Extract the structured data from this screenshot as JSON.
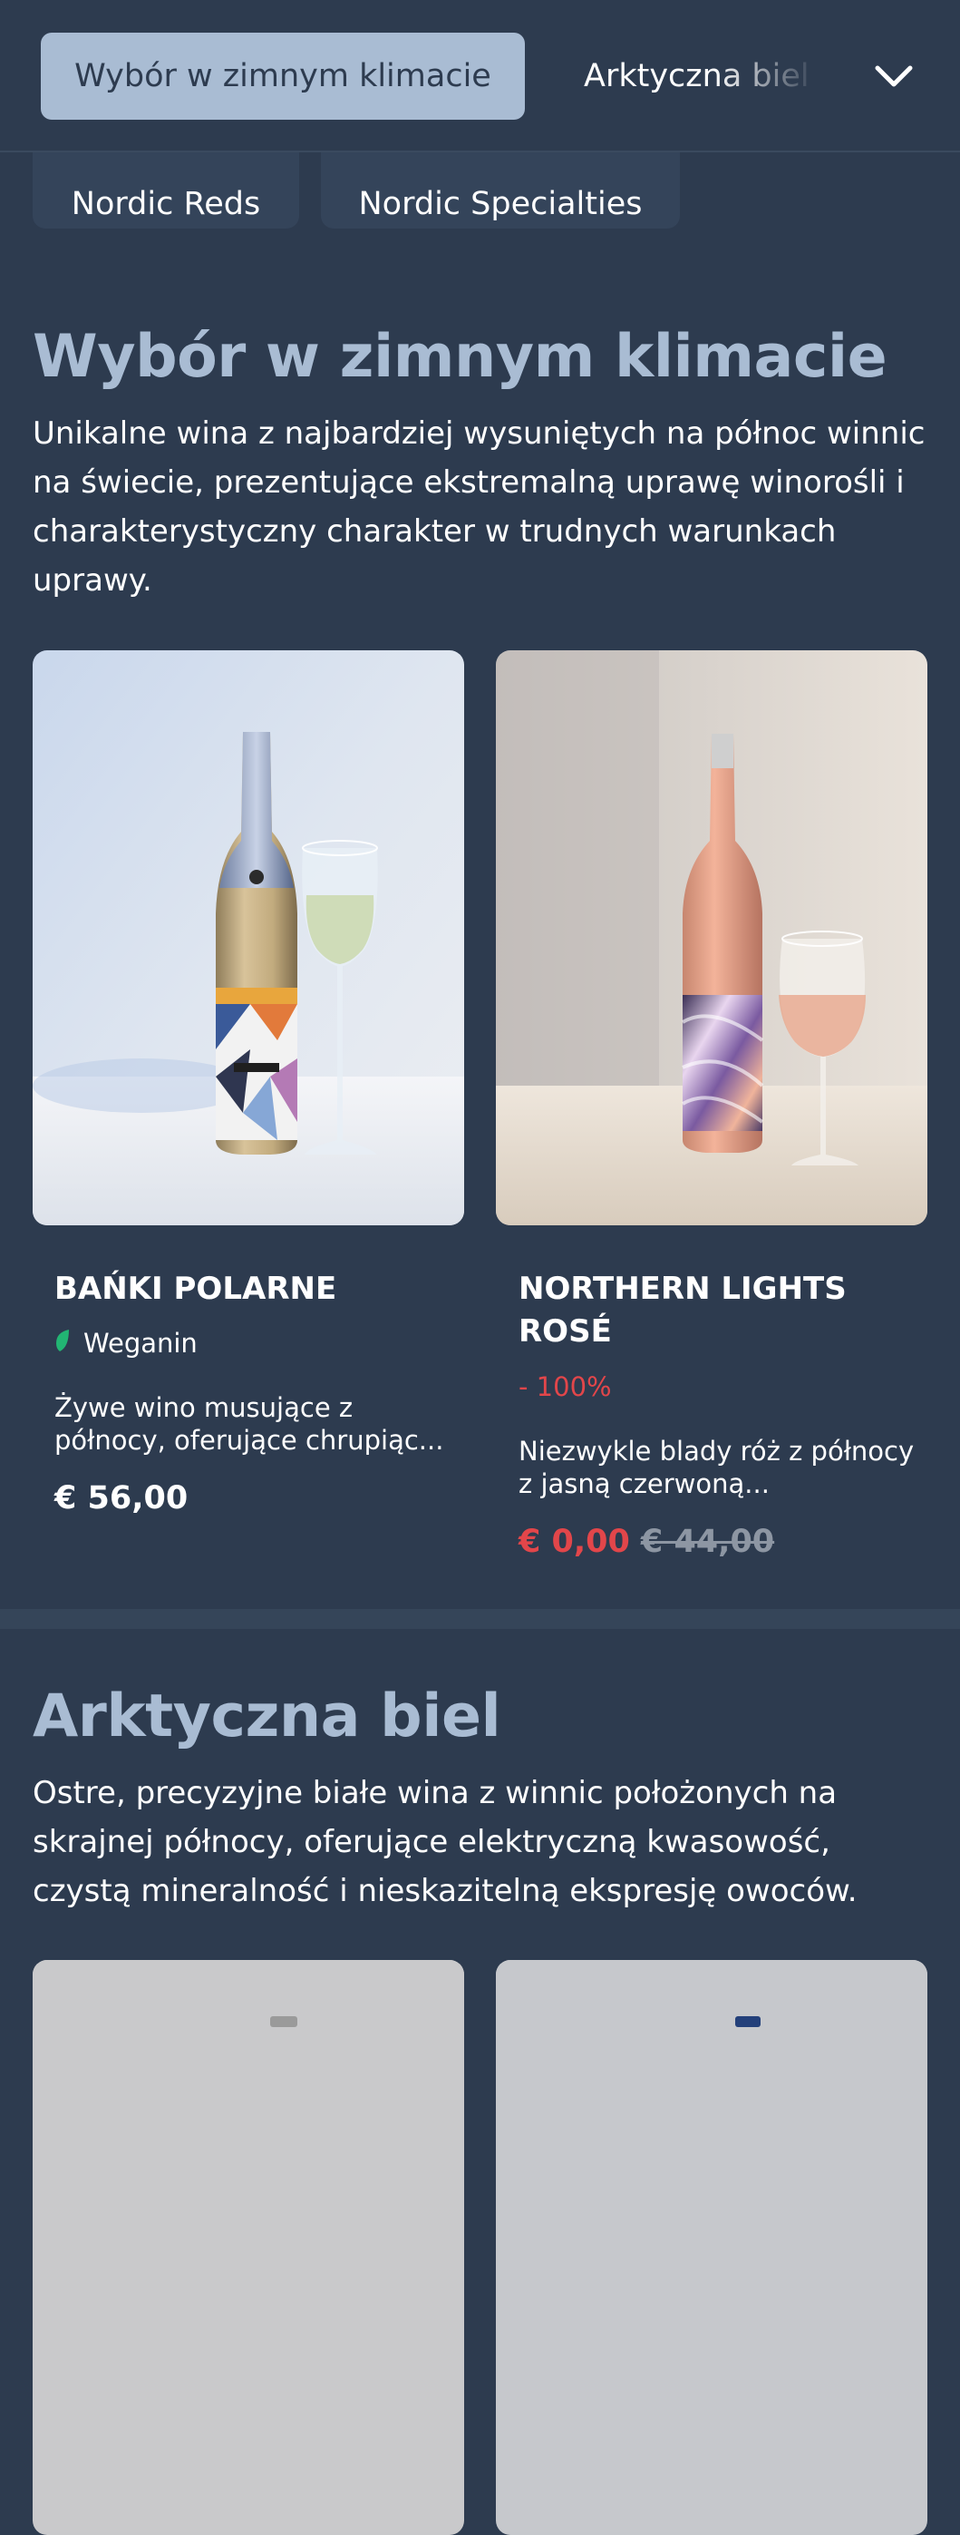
{
  "nav": {
    "active_tab": "Wybór w zimnym klimacie",
    "next_tab": "Arktyczna biel",
    "chevron_icon": "chevron-down-icon"
  },
  "categories": [
    "Nordic Reds",
    "Nordic Specialties"
  ],
  "section1": {
    "title": "Wybór w zimnym klimacie",
    "description": "Unikalne wina z najbardziej wysuniętych na północ winnic na świecie, prezentujące ekstremalną uprawę winorośli i charakterystyczny charakter w trudnych warunkach uprawy.",
    "products": [
      {
        "name": "BAŃKI POLARNE",
        "badge": "Weganin",
        "badge_icon": "leaf-icon",
        "description": "Żywe wino musujące z północy, oferujące chrupiąc...",
        "price": "€ 56,00"
      },
      {
        "name": "NORTHERN LIGHTS ROSÉ",
        "discount": "- 100%",
        "description": "Niezwykle blady róż z północy z jasną czerwoną...",
        "price": "€ 0,00",
        "old_price": "€ 44,00"
      }
    ]
  },
  "section2": {
    "title": "Arktyczna biel",
    "description": "Ostre, precyzyjne białe wina z winnic położonych na skrajnej północy, oferujące elektryczną kwasowość, czystą mineralność i nieskazitelną ekspresję owoców."
  },
  "colors": {
    "background": "#2d3b4f",
    "accent": "#a9bcd3",
    "sale": "#e2464a",
    "vegan": "#22b573"
  }
}
